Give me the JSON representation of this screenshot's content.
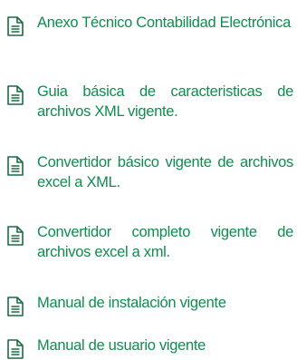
{
  "colors": {
    "link": "#0d8d4f",
    "icon": "#1a6b42",
    "background": "#ffffff"
  },
  "documents": [
    {
      "label": "Anexo Técnico Contabilidad Electrónica",
      "icon": "document-icon"
    },
    {
      "label": "Guia básica de caracteristicas de archivos XML vigente.",
      "icon": "document-icon"
    },
    {
      "label": "Convertidor básico vigente de archivos excel a XML.",
      "icon": "document-icon"
    },
    {
      "label": "Convertidor completo vigente de archivos excel a xml.",
      "icon": "document-icon"
    },
    {
      "label": "Manual de instalación vigente",
      "icon": "document-icon"
    },
    {
      "label": "Manual de usuario vigente",
      "icon": "document-icon"
    }
  ]
}
